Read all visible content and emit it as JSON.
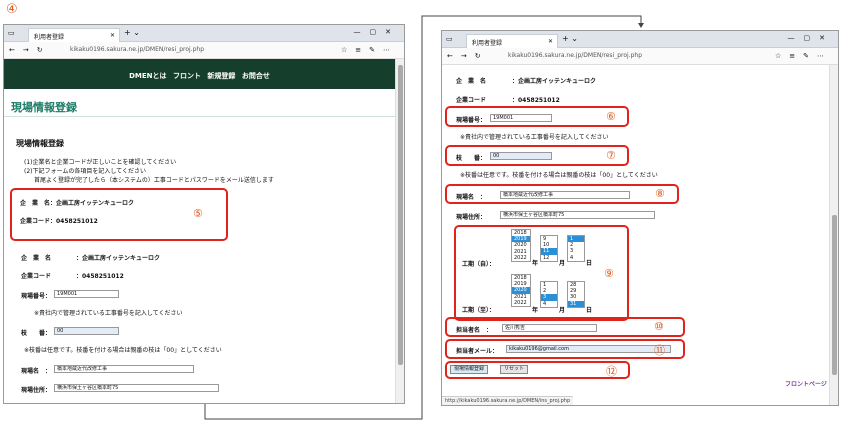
{
  "step_labels": {
    "s4": "④",
    "s5": "⑤",
    "s6": "⑥",
    "s7": "⑦",
    "s8": "⑧",
    "s9": "⑨",
    "s10": "⑩",
    "s11": "⑪",
    "s12": "⑫"
  },
  "browser": {
    "tab_title": "利用者登録",
    "url": "kikaku0196.sakura.ne.jp/DMEN/resi_proj.php"
  },
  "left": {
    "nav": "DMENとは フロント 新規登録 お問合せ",
    "page_title": "現場情報登録",
    "section_title": "現場情報登録",
    "instructions": [
      "(1)企業名と企業コードが正しいことを確認してください",
      "(2)下記フォームの各項目を記入してください",
      "首尾よく登録が完了したら（本システムの）工事コードとパスワードをメール送信します"
    ],
    "box_company": "企　業　名：企画工房イッテンキューロク",
    "box_code": "企業コード：0458251012",
    "company_label": "企　業　名",
    "company_value": "：企画工房イッテンキューロク",
    "code_label": "企業コード",
    "code_value": "：0458251012",
    "site_no_label": "現場番号：",
    "site_no_value": "19M001",
    "site_no_note": "※貴社内で管理されている工事番号を記入してください",
    "branch_label": "枝　　番：",
    "branch_value": "00",
    "branch_note": "※枝番は任意です。枝番を付ける場合は親番の枝は「00」としてください",
    "site_name_label": "現場名　：",
    "site_name_value": "橋本地蔵近代改修工事",
    "site_addr_label": "現場住所：",
    "site_addr_value": "横浜市保土ヶ谷区橋本町75"
  },
  "right": {
    "company_label": "企　業　名",
    "company_value": "：企画工房イッテンキューロク",
    "code_label": "企業コード",
    "code_value": "：0458251012",
    "site_no_label": "現場番号：",
    "site_no_value": "19M001",
    "site_no_note": "※貴社内で管理されている工事番号を記入してください",
    "branch_label": "枝　　番：",
    "branch_value": "00",
    "branch_note": "※枝番は任意です。枝番を付ける場合は親番の枝は「00」としてください",
    "site_name_label": "現場名　：",
    "site_name_value": "橋本地蔵近代改修工事",
    "site_addr_label": "現場住所：",
    "site_addr_value": "横浜市保土ヶ谷区橋本町75",
    "period_from_label": "工期（自）：",
    "period_to_label": "工期（至）：",
    "year_suffix": "年",
    "month_suffix": "月",
    "day_suffix": "日",
    "from_years": [
      "2018",
      "2019",
      "2020",
      "2021",
      "2022"
    ],
    "from_months": [
      "9",
      "10",
      "11",
      "12"
    ],
    "from_days": [
      "1",
      "2",
      "3",
      "4"
    ],
    "to_years": [
      "2018",
      "2019",
      "2020",
      "2021",
      "2022"
    ],
    "to_months": [
      "1",
      "2",
      "3",
      "4"
    ],
    "to_days": [
      "28",
      "29",
      "30",
      "31"
    ],
    "person_label": "担当者名　：",
    "person_value": "佐川秀吉",
    "mail_label": "担当者メール：",
    "mail_value": "kikaku0196@gmail.com",
    "register_button": "現場情報登録",
    "reset_button": "リセット",
    "front_link": "フロントページ",
    "status_url": "http://kikaku0196.sakura.ne.jp/DMEN/ins_proj.php"
  }
}
